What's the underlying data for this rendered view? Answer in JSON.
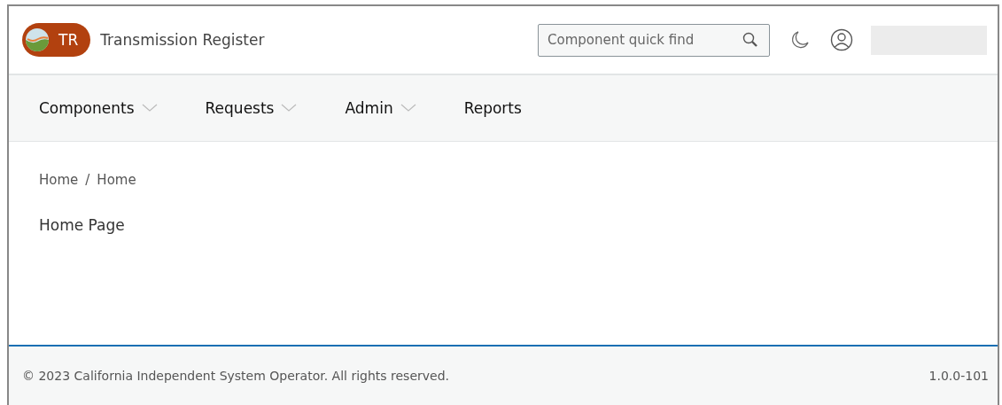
{
  "header": {
    "logo_badge": "TR",
    "app_title": "Transmission Register",
    "search": {
      "placeholder": "Component quick find"
    }
  },
  "nav": [
    {
      "label": "Components",
      "dropdown": true
    },
    {
      "label": "Requests",
      "dropdown": true
    },
    {
      "label": "Admin",
      "dropdown": true
    },
    {
      "label": "Reports",
      "dropdown": false
    }
  ],
  "breadcrumb": [
    "Home",
    "/",
    "Home"
  ],
  "page_text": "Home Page",
  "footer": {
    "copyright": "© 2023 California Independent System Operator. All rights reserved.",
    "version": "1.0.0-101"
  }
}
